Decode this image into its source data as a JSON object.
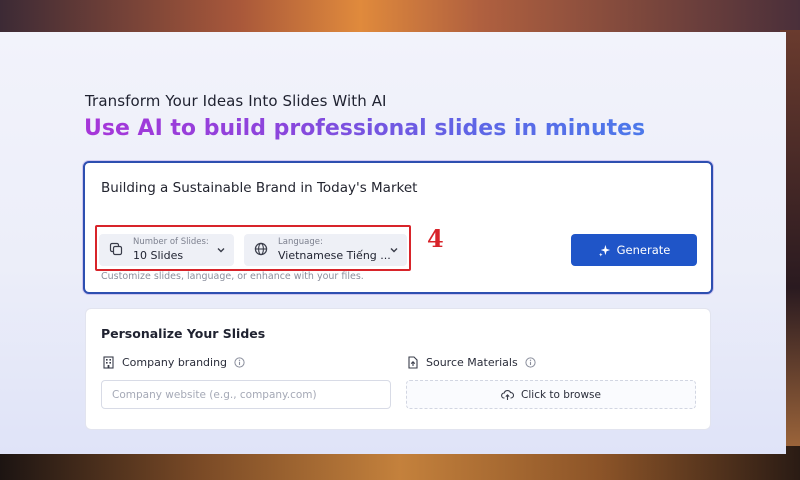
{
  "hero": {
    "eyebrow": "Transform Your Ideas Into Slides With AI",
    "headline": "Use AI to build professional slides in minutes"
  },
  "prompt": {
    "text": "Building a Sustainable Brand in Today's Market",
    "slides_label": "Number of Slides:",
    "slides_value": "10 Slides",
    "language_label": "Language:",
    "language_value": "Vietnamese Tiếng ...",
    "hint": "Customize slides, language, or enhance with your files.",
    "generate_label": "Generate"
  },
  "annotation": {
    "step_number": "4",
    "color": "#d8242a"
  },
  "personalize": {
    "title": "Personalize Your Slides",
    "branding_label": "Company branding",
    "website_placeholder": "Company website (e.g., company.com)",
    "source_label": "Source Materials",
    "browse_label": "Click to browse"
  },
  "colors": {
    "accent": "#1f55c8",
    "gradient_start": "#a736d9",
    "gradient_end": "#4c79ea"
  }
}
